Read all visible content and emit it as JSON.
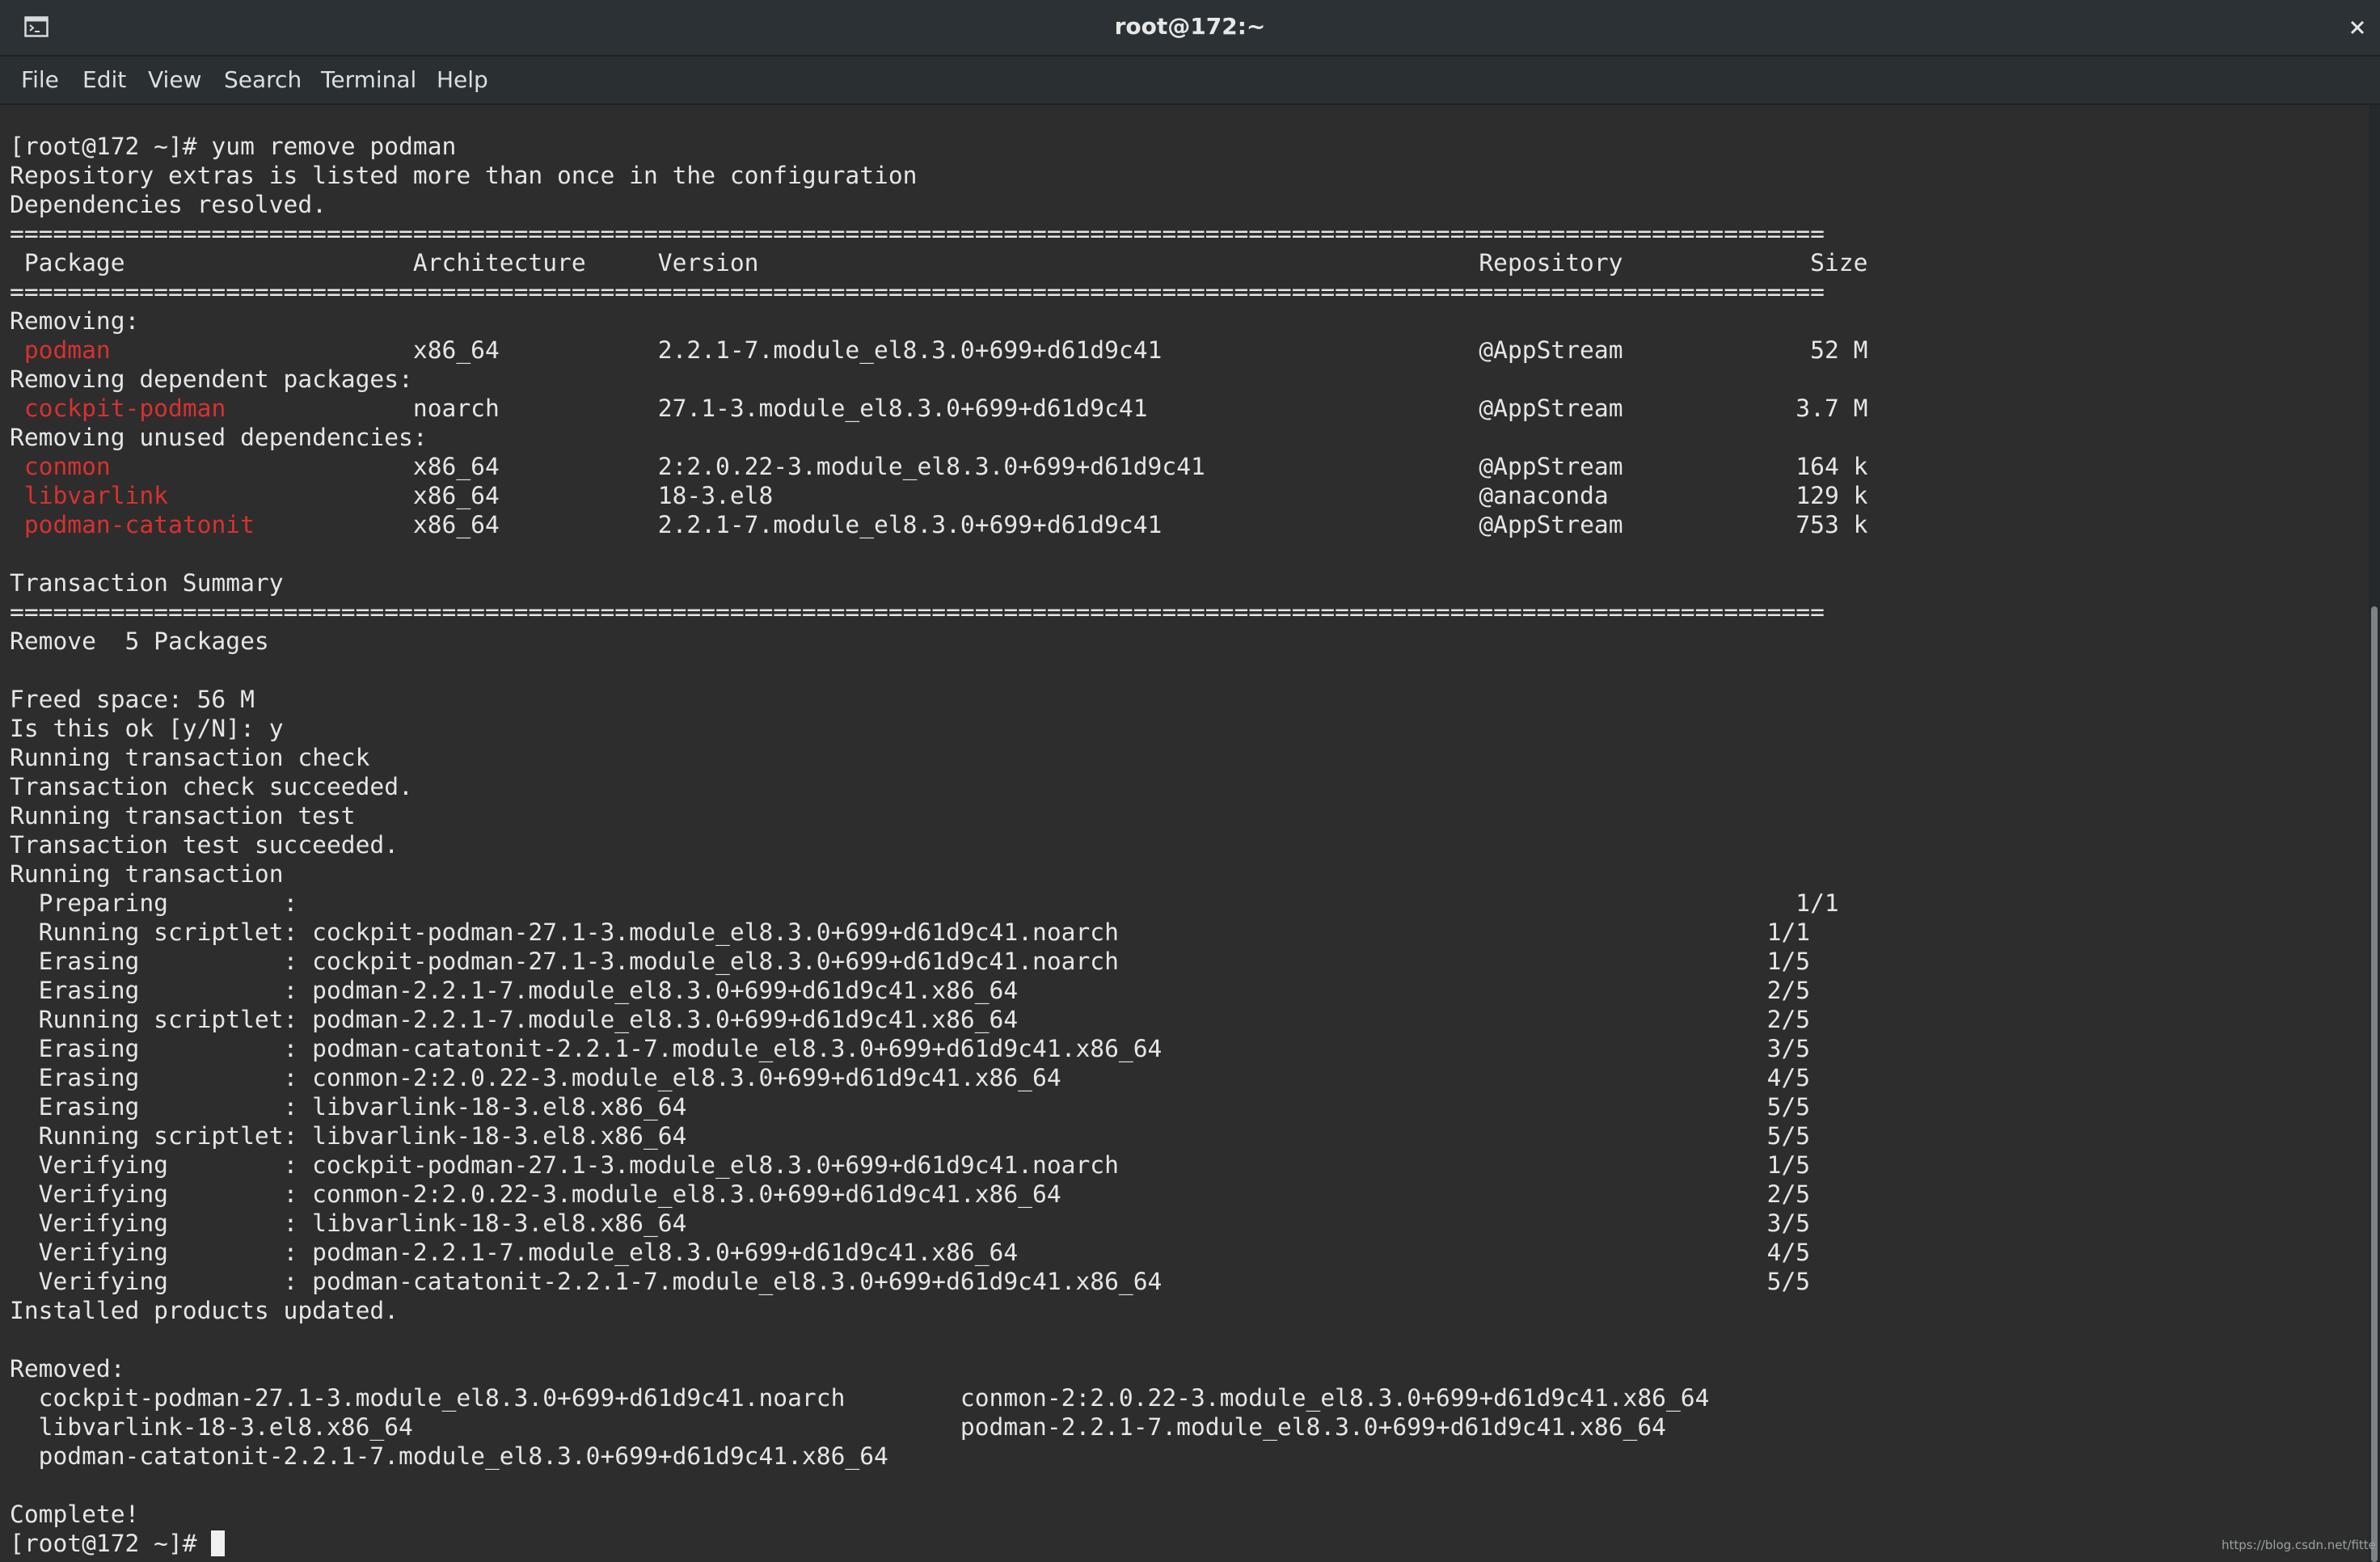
{
  "window": {
    "title": "root@172:~",
    "icons": {
      "terminal": "terminal-icon",
      "close": "close-icon"
    }
  },
  "menu": {
    "items": [
      "File",
      "Edit",
      "View",
      "Search",
      "Terminal",
      "Help"
    ]
  },
  "terminal": {
    "lines": [
      [
        {
          "t": "[root@172 ~]# yum remove podman"
        }
      ],
      [
        {
          "t": "Repository extras is listed more than once in the configuration"
        }
      ],
      [
        {
          "t": "Dependencies resolved."
        }
      ],
      [
        {
          "t": "=============================================================================================================================="
        }
      ],
      [
        {
          "t": " Package                    Architecture     Version                                                  Repository             Size"
        }
      ],
      [
        {
          "t": "=============================================================================================================================="
        }
      ],
      [
        {
          "t": "Removing:"
        }
      ],
      [
        {
          "t": " "
        },
        {
          "t": "podman",
          "c": "red"
        },
        {
          "t": "                     x86_64           2.2.1-7.module_el8.3.0+699+d61d9c41                      @AppStream             52 M"
        }
      ],
      [
        {
          "t": "Removing dependent packages:"
        }
      ],
      [
        {
          "t": " "
        },
        {
          "t": "cockpit-podman",
          "c": "red"
        },
        {
          "t": "             noarch           27.1-3.module_el8.3.0+699+d61d9c41                       @AppStream            3.7 M"
        }
      ],
      [
        {
          "t": "Removing unused dependencies:"
        }
      ],
      [
        {
          "t": " "
        },
        {
          "t": "conmon",
          "c": "red"
        },
        {
          "t": "                     x86_64           2:2.0.22-3.module_el8.3.0+699+d61d9c41                   @AppStream            164 k"
        }
      ],
      [
        {
          "t": " "
        },
        {
          "t": "libvarlink",
          "c": "red"
        },
        {
          "t": "                 x86_64           18-3.el8                                                 @anaconda             129 k"
        }
      ],
      [
        {
          "t": " "
        },
        {
          "t": "podman-catatonit",
          "c": "red"
        },
        {
          "t": "           x86_64           2.2.1-7.module_el8.3.0+699+d61d9c41                      @AppStream            753 k"
        }
      ],
      [
        {
          "t": ""
        }
      ],
      [
        {
          "t": "Transaction Summary"
        }
      ],
      [
        {
          "t": "=============================================================================================================================="
        }
      ],
      [
        {
          "t": "Remove  5 Packages"
        }
      ],
      [
        {
          "t": ""
        }
      ],
      [
        {
          "t": "Freed space: 56 M"
        }
      ],
      [
        {
          "t": "Is this ok [y/N]: y"
        }
      ],
      [
        {
          "t": "Running transaction check"
        }
      ],
      [
        {
          "t": "Transaction check succeeded."
        }
      ],
      [
        {
          "t": "Running transaction test"
        }
      ],
      [
        {
          "t": "Transaction test succeeded."
        }
      ],
      [
        {
          "t": "Running transaction"
        }
      ],
      [
        {
          "t": "  Preparing        :                                                                                                        1/1"
        }
      ],
      [
        {
          "t": "  Running scriptlet: cockpit-podman-27.1-3.module_el8.3.0+699+d61d9c41.noarch                                             1/1"
        }
      ],
      [
        {
          "t": "  Erasing          : cockpit-podman-27.1-3.module_el8.3.0+699+d61d9c41.noarch                                             1/5"
        }
      ],
      [
        {
          "t": "  Erasing          : podman-2.2.1-7.module_el8.3.0+699+d61d9c41.x86_64                                                    2/5"
        }
      ],
      [
        {
          "t": "  Running scriptlet: podman-2.2.1-7.module_el8.3.0+699+d61d9c41.x86_64                                                    2/5"
        }
      ],
      [
        {
          "t": "  Erasing          : podman-catatonit-2.2.1-7.module_el8.3.0+699+d61d9c41.x86_64                                          3/5"
        }
      ],
      [
        {
          "t": "  Erasing          : conmon-2:2.0.22-3.module_el8.3.0+699+d61d9c41.x86_64                                                 4/5"
        }
      ],
      [
        {
          "t": "  Erasing          : libvarlink-18-3.el8.x86_64                                                                           5/5"
        }
      ],
      [
        {
          "t": "  Running scriptlet: libvarlink-18-3.el8.x86_64                                                                           5/5"
        }
      ],
      [
        {
          "t": "  Verifying        : cockpit-podman-27.1-3.module_el8.3.0+699+d61d9c41.noarch                                             1/5"
        }
      ],
      [
        {
          "t": "  Verifying        : conmon-2:2.0.22-3.module_el8.3.0+699+d61d9c41.x86_64                                                 2/5"
        }
      ],
      [
        {
          "t": "  Verifying        : libvarlink-18-3.el8.x86_64                                                                           3/5"
        }
      ],
      [
        {
          "t": "  Verifying        : podman-2.2.1-7.module_el8.3.0+699+d61d9c41.x86_64                                                    4/5"
        }
      ],
      [
        {
          "t": "  Verifying        : podman-catatonit-2.2.1-7.module_el8.3.0+699+d61d9c41.x86_64                                          5/5"
        }
      ],
      [
        {
          "t": "Installed products updated."
        }
      ],
      [
        {
          "t": ""
        }
      ],
      [
        {
          "t": "Removed:"
        }
      ],
      [
        {
          "t": "  cockpit-podman-27.1-3.module_el8.3.0+699+d61d9c41.noarch        conmon-2:2.0.22-3.module_el8.3.0+699+d61d9c41.x86_64"
        }
      ],
      [
        {
          "t": "  libvarlink-18-3.el8.x86_64                                      podman-2.2.1-7.module_el8.3.0+699+d61d9c41.x86_64"
        }
      ],
      [
        {
          "t": "  podman-catatonit-2.2.1-7.module_el8.3.0+699+d61d9c41.x86_64"
        }
      ],
      [
        {
          "t": ""
        }
      ],
      [
        {
          "t": "Complete!"
        }
      ]
    ],
    "prompt": "[root@172 ~]# "
  },
  "watermark": "https://blog.csdn.net/fittec",
  "colors": {
    "background": "#2d2d2d",
    "foreground": "#e6e6e6",
    "package_highlight": "#d9312f"
  }
}
